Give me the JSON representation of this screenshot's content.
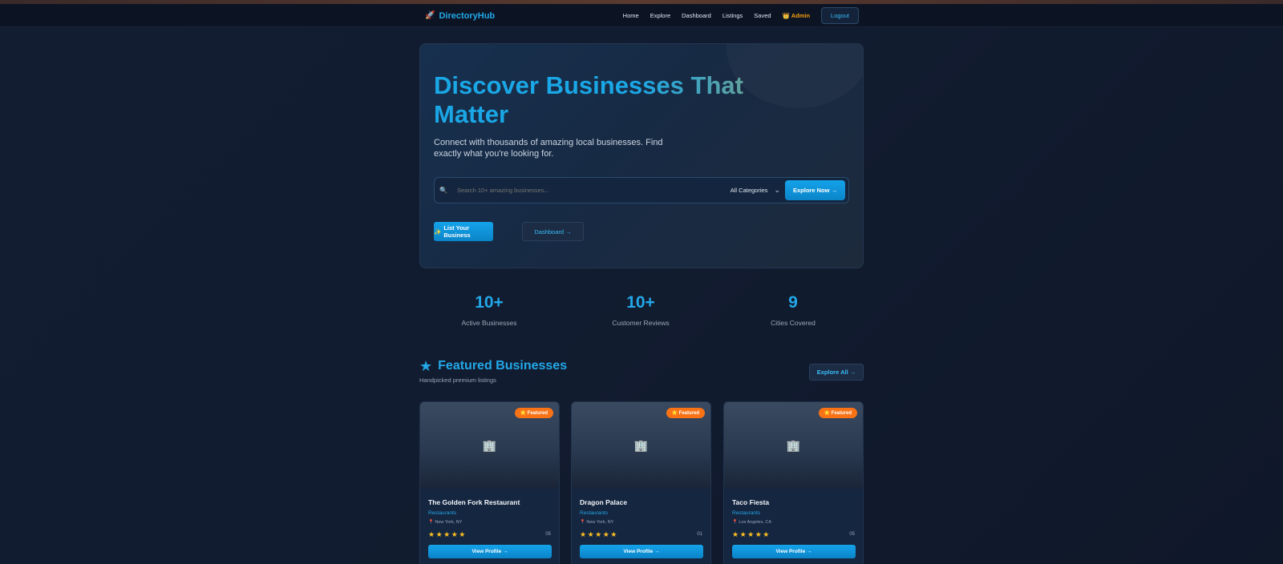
{
  "nav": {
    "brand": "DirectoryHub",
    "brand_icon": "🚀",
    "links": [
      "Home",
      "Explore",
      "Dashboard",
      "Listings",
      "Saved"
    ],
    "admin_icon": "👑",
    "admin_label": "Admin",
    "logout_label": "Logout"
  },
  "hero": {
    "title": "Discover Businesses That Matter",
    "subtitle": "Connect with thousands of amazing local businesses. Find exactly what you're looking for.",
    "search_placeholder": "Search 10+ amazing businesses...",
    "search_icon": "🔍",
    "category_selected": "All Categories",
    "chevron_icon": "⌄",
    "explore_label": "Explore Now →",
    "list_business_icon": "✨",
    "list_business_label": "List Your Business",
    "dashboard_label": "Dashboard →"
  },
  "stats": [
    {
      "value": "10+",
      "label": "Active Businesses"
    },
    {
      "value": "10+",
      "label": "Customer Reviews"
    },
    {
      "value": "9",
      "label": "Cities Covered"
    }
  ],
  "featured": {
    "title": "Featured Businesses",
    "subtitle": "Handpicked premium listings",
    "explore_all_label": "Explore All →",
    "star_icon": "★",
    "cards": [
      {
        "name": "The Golden Fork Restaurant",
        "category": "Restaurants",
        "location": "New York, NY",
        "badge": "⭐ Featured",
        "rating_text": "05",
        "stars": 5,
        "view_label": "View Profile →"
      },
      {
        "name": "Dragon Palace",
        "category": "Restaurants",
        "location": "New York, NY",
        "badge": "⭐ Featured",
        "rating_text": "01",
        "stars": 5,
        "view_label": "View Profile →"
      },
      {
        "name": "Taco Fiesta",
        "category": "Restaurants",
        "location": "Los Angeles, CA",
        "badge": "⭐ Featured",
        "rating_text": "05",
        "stars": 5,
        "view_label": "View Profile →"
      }
    ]
  },
  "colors": {
    "accent": "#22a8e8",
    "background": "#111b2e",
    "badge": "#f97316",
    "star": "#fbbf24",
    "admin": "#f59e0b"
  }
}
